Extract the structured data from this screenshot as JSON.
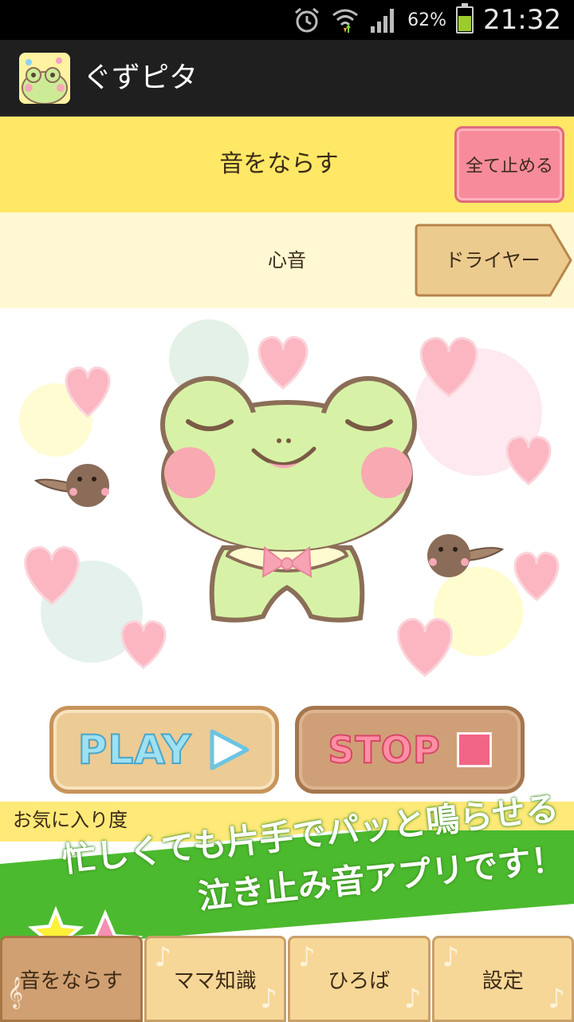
{
  "status_bar": {
    "battery": "62%",
    "time": "21:32",
    "icons": [
      "alarm-icon",
      "wifi-icon",
      "signal-icon",
      "battery-icon"
    ]
  },
  "app": {
    "title": "ぐずピタ",
    "logo_icon": "frog-app-icon"
  },
  "sound_header": {
    "label": "音をならす",
    "stop_all_label": "全て止める"
  },
  "track": {
    "current": "心音",
    "next": "ドライヤー"
  },
  "controls": {
    "play_label": "PLAY",
    "stop_label": "STOP"
  },
  "favorite": {
    "label": "お気に入り度"
  },
  "banner": {
    "line1": "忙しくても片手でパッと鳴らせる",
    "line2": "泣き止み音アプリです！"
  },
  "tabs": [
    {
      "label": "音をならす",
      "active": true
    },
    {
      "label": "ママ知識",
      "active": false
    },
    {
      "label": "ひろば",
      "active": false
    },
    {
      "label": "設定",
      "active": false
    }
  ],
  "colors": {
    "header_yellow": "#ffe866",
    "stop_all_pink": "#f78b9b",
    "banner_green": "#4cba2f",
    "frog_green": "#d7f2a6"
  }
}
